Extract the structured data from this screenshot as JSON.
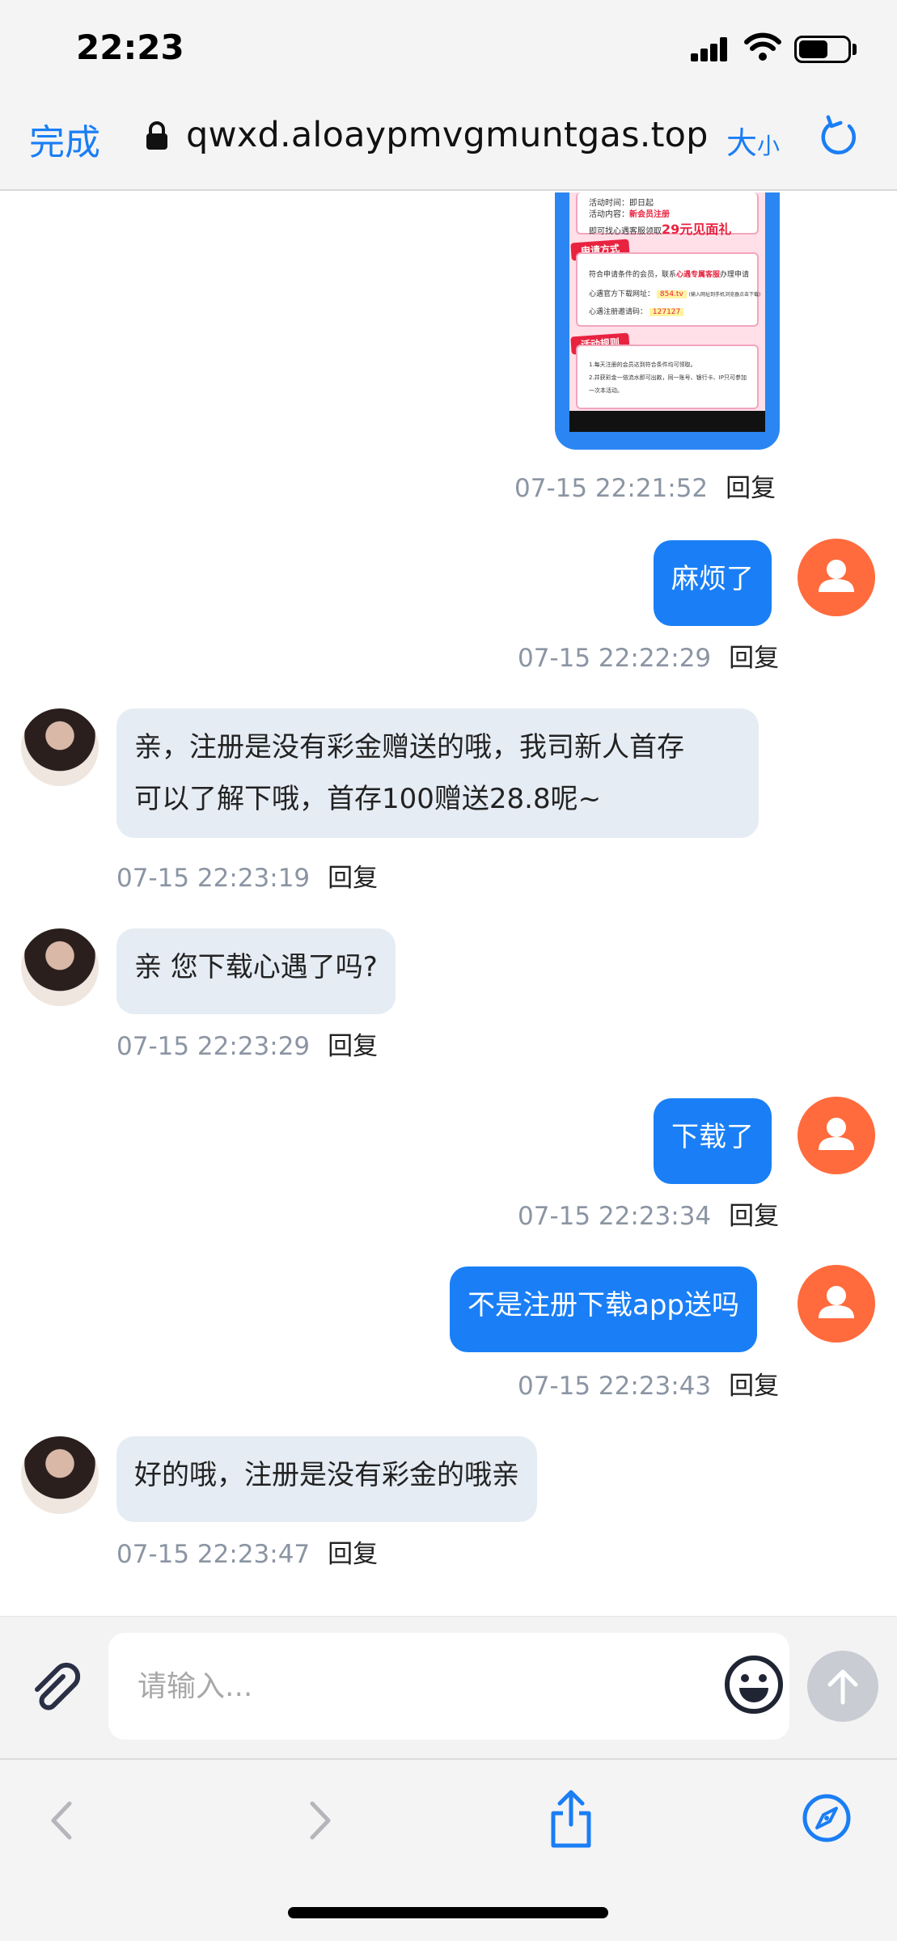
{
  "status_bar": {
    "time": "22:23",
    "battery_level": 0.6
  },
  "browser": {
    "done_label": "完成",
    "url": "qwxd.aloaypmvgmuntgas.top",
    "text_size_large": "大",
    "text_size_small": "小"
  },
  "promo_image": {
    "activity_time": "活动时间：即日起",
    "activity_content_label": "活动内容：",
    "activity_content_value": "新会员注册",
    "gift_line_prefix": "即可找心遇客服领取",
    "gift_amount": "29元见面礼",
    "apply_ribbon": "申请方式",
    "apply_line_prefix": "符合申请条件的会员，联系",
    "apply_line_highlight": "心遇专属客服",
    "apply_line_suffix": "办理申请",
    "download_label": "心遇官方下载网址：",
    "download_value": "854.tv",
    "download_note": "(输入网址到手机浏览器点击下载)",
    "code_label": "心遇注册邀请码：",
    "code_value": "127127",
    "rules_ribbon": "活动规则",
    "rule_1": "1.每天注册的会员达到符合条件均可领取。",
    "rule_2": "2.并获彩金一倍流水即可出款，同一账号、银行卡、IP只可参加",
    "rule_3": "一次本活动。"
  },
  "messages": [
    {
      "sender": "agent",
      "kind": "image",
      "time": "07-15 22:21:52",
      "reply": "回复"
    },
    {
      "sender": "user",
      "text": "麻烦了",
      "time": "07-15 22:22:29",
      "reply": "回复"
    },
    {
      "sender": "agent",
      "lines": [
        "亲，注册是没有彩金赠送的哦，我司新人首存",
        "可以了解下哦，首存100赠送28.8呢~"
      ],
      "time": "07-15 22:23:19",
      "reply": "回复"
    },
    {
      "sender": "agent",
      "text": "亲 您下载心遇了吗?",
      "time": "07-15 22:23:29",
      "reply": "回复"
    },
    {
      "sender": "user",
      "text": "下载了",
      "time": "07-15 22:23:34",
      "reply": "回复"
    },
    {
      "sender": "user",
      "text": "不是注册下载app送吗",
      "time": "07-15 22:23:43",
      "reply": "回复"
    },
    {
      "sender": "agent",
      "text": "好的哦，注册是没有彩金的哦亲",
      "time": "07-15 22:23:47",
      "reply": "回复"
    }
  ],
  "input": {
    "placeholder": "请输入..."
  },
  "icons": {
    "attach": "paperclip-icon",
    "emoji": "emoji-icon",
    "send": "arrow-up-icon",
    "back": "chevron-left-icon",
    "forward": "chevron-right-icon",
    "share": "share-icon",
    "bookmarks": "compass-icon"
  },
  "colors": {
    "accent": "#1a7ef5",
    "user_bubble": "#1a7ff6",
    "agent_bubble": "#e6ecf4",
    "user_avatar": "#ff6b3d"
  }
}
